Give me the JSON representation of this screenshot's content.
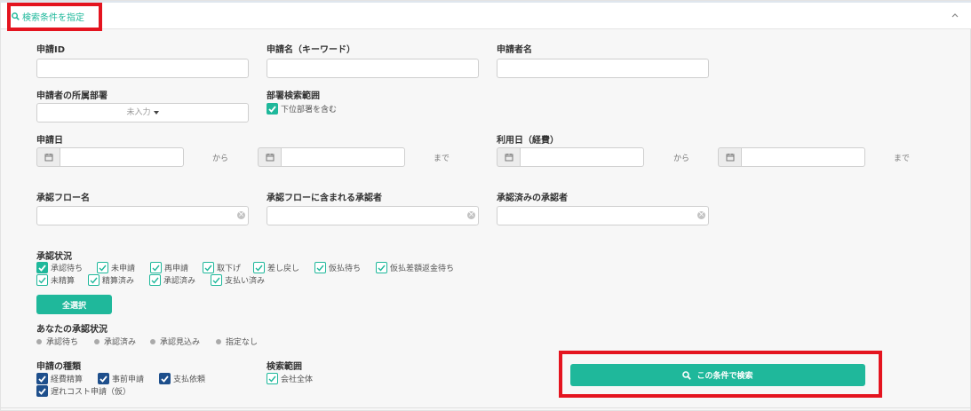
{
  "header": {
    "search_toggle_label": "検索条件を指定"
  },
  "fields": {
    "application_id": {
      "label": "申請ID",
      "value": ""
    },
    "application_name": {
      "label": "申請名（キーワード）",
      "value": ""
    },
    "applicant_name": {
      "label": "申請者名",
      "value": ""
    },
    "applicant_dept": {
      "label": "申請者の所属部署",
      "selected": "未入力"
    },
    "dept_scope": {
      "label": "部署検索範囲",
      "checkbox": "下位部署を含む",
      "checked": true
    },
    "application_date": {
      "label": "申請日",
      "from": "から",
      "to": "まで"
    },
    "usage_date": {
      "label": "利用日（経費）",
      "from": "から",
      "to": "まで"
    },
    "approval_flow_name": {
      "label": "承認フロー名",
      "value": ""
    },
    "approver_in_flow": {
      "label": "承認フローに含まれる承認者",
      "value": ""
    },
    "approved_approver": {
      "label": "承認済みの承認者",
      "value": ""
    }
  },
  "approval_status": {
    "label": "承認状況",
    "row1": [
      "承認待ち",
      "未申請",
      "再申請",
      "取下げ",
      "差し戻し",
      "仮払待ち",
      "仮払差額返金待ち"
    ],
    "row2": [
      "未精算",
      "精算済み",
      "承認済み",
      "支払い済み"
    ],
    "select_all_label": "全選択"
  },
  "your_status": {
    "label": "あなたの承認状況",
    "options": [
      "承認待ち",
      "承認済み",
      "承認見込み",
      "指定なし"
    ]
  },
  "application_type": {
    "label": "申請の種類",
    "options": [
      "経費精算",
      "事前申請",
      "支払依頼",
      "遅れコスト申請（仮）"
    ]
  },
  "search_scope": {
    "label": "検索範囲",
    "option": "会社全体"
  },
  "search_button_label": "この条件で検索",
  "colors": {
    "accent": "#1fb89b",
    "navy": "#1e4f8c",
    "highlight": "#e4141f"
  }
}
